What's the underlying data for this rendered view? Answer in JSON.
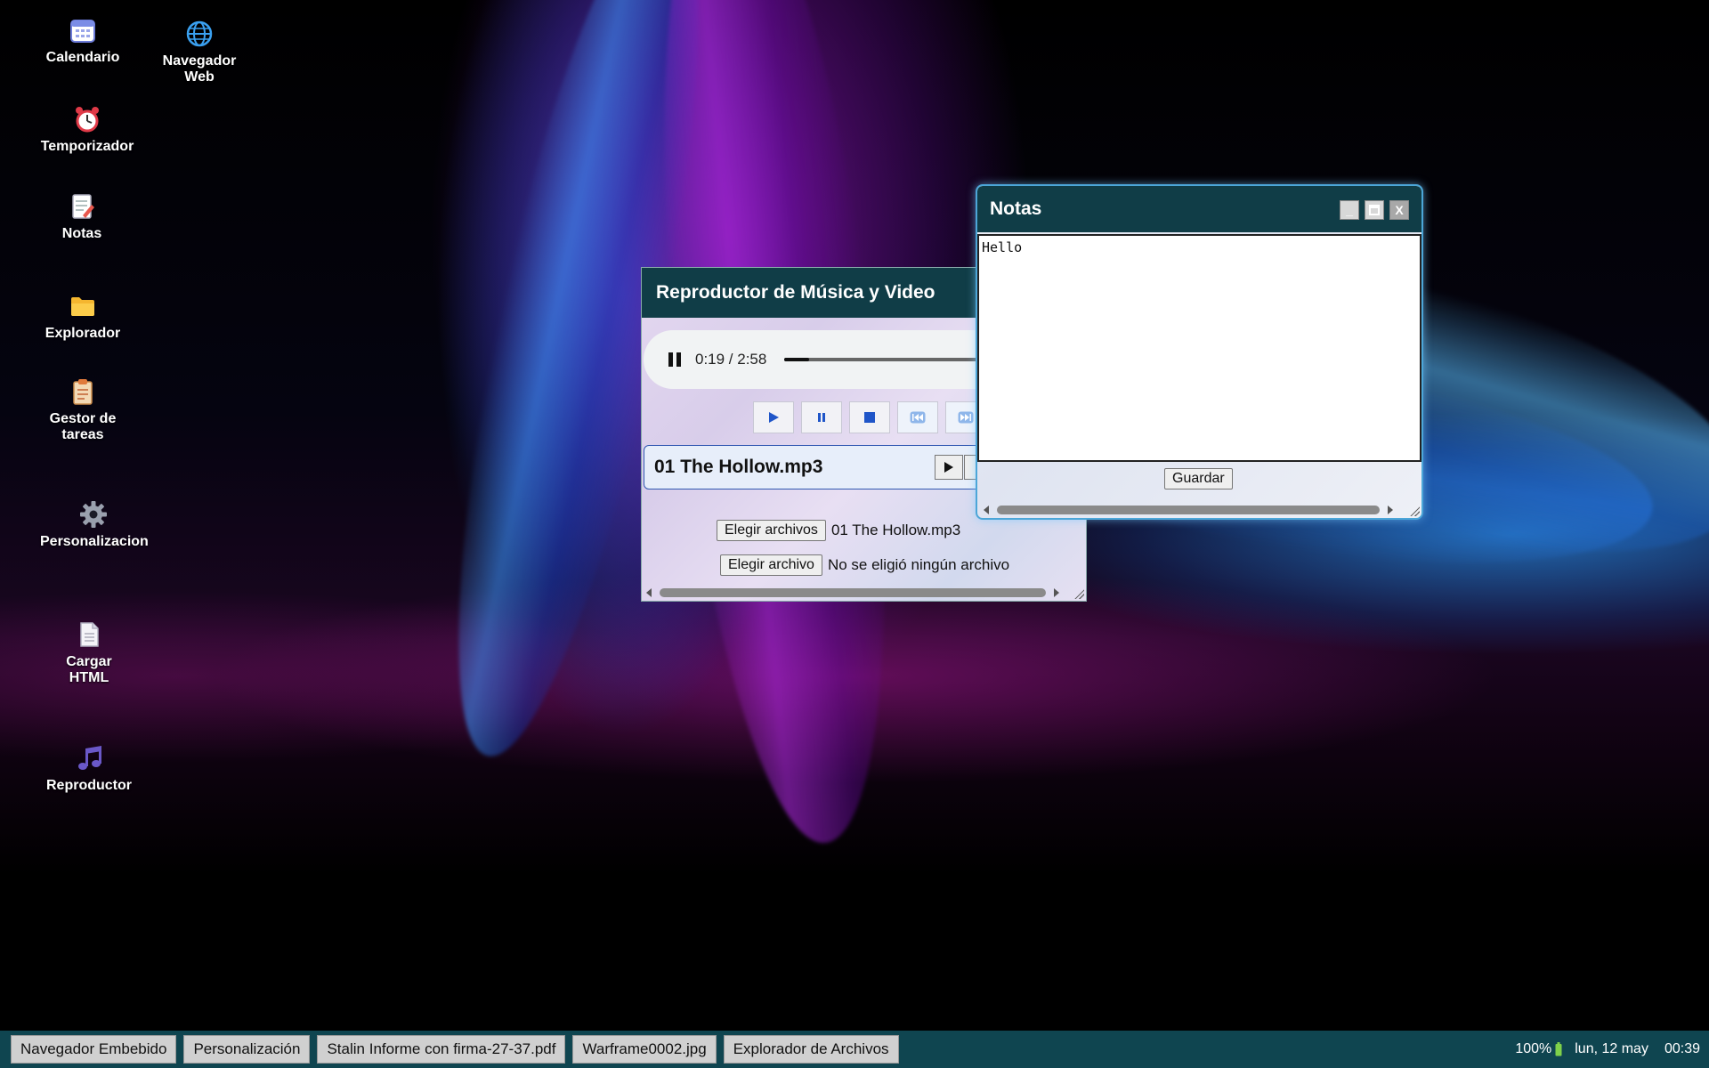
{
  "desktop_icons": [
    {
      "label": "Calendario",
      "icon": "calendar-icon"
    },
    {
      "label": "Navegador Web",
      "icon": "globe-icon"
    },
    {
      "label": "Temporizador",
      "icon": "alarm-clock-icon"
    },
    {
      "label": "Notas",
      "icon": "notepad-icon"
    },
    {
      "label": "Explorador",
      "icon": "folder-icon"
    },
    {
      "label": "Gestor de tareas",
      "icon": "clipboard-icon"
    },
    {
      "label": "Personalizacion",
      "icon": "gear-icon"
    },
    {
      "label": "Cargar HTML",
      "icon": "document-icon"
    },
    {
      "label": "Reproductor",
      "icon": "music-note-icon"
    }
  ],
  "player_window": {
    "title": "Reproductor de Música y Video",
    "audio": {
      "time": "0:19 / 2:58",
      "progress": 0.107
    },
    "song_name": "01 The Hollow.mp3",
    "files_button": "Elegir archivos",
    "files_status": "01 The Hollow.mp3",
    "file_button": "Elegir archivo",
    "file_status": "No se eligió ningún archivo"
  },
  "notes_window": {
    "title": "Notas",
    "content": "Hello",
    "save_label": "Guardar",
    "minimize": "_",
    "close": "X"
  },
  "taskbar": {
    "items": [
      "Navegador Embebido",
      "Personalización",
      "Stalin Informe con firma-27-37.pdf",
      "Warframe0002.jpg",
      "Explorador de Archivos"
    ],
    "battery": "100%",
    "date": "lun, 12 may",
    "time": "00:39"
  },
  "colors": {
    "titlebar": "#103d47",
    "taskbar": "#0f4550",
    "accent_blue": "#1f55c8"
  }
}
